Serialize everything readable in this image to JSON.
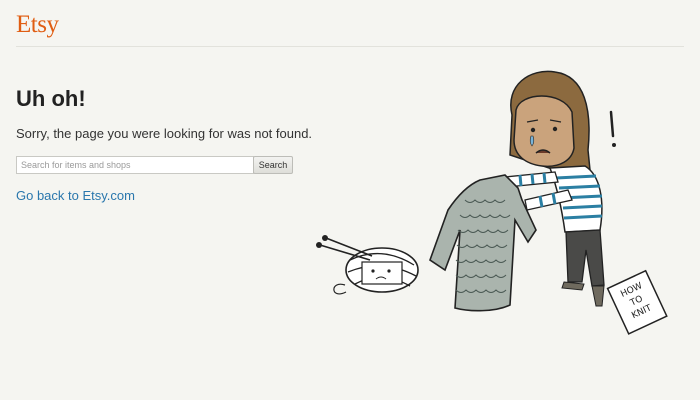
{
  "header": {
    "logo_text": "Etsy"
  },
  "main": {
    "heading": "Uh oh!",
    "message": "Sorry, the page you were looking for was not found.",
    "search": {
      "placeholder": "Search for items and shops",
      "value": "",
      "button_label": "Search"
    },
    "back_link": "Go back to Etsy.com"
  },
  "illustration": {
    "description_icons": [
      "crying-knitter-illustration",
      "yarn-ball-icon",
      "sweater-icon",
      "instruction-sheet-icon"
    ],
    "sheet_text": [
      "HOW",
      "TO",
      "KNIT"
    ],
    "exclamation": "!"
  },
  "colors": {
    "brand": "#e05d12",
    "link": "#2a77ad",
    "background": "#f5f5f1"
  }
}
